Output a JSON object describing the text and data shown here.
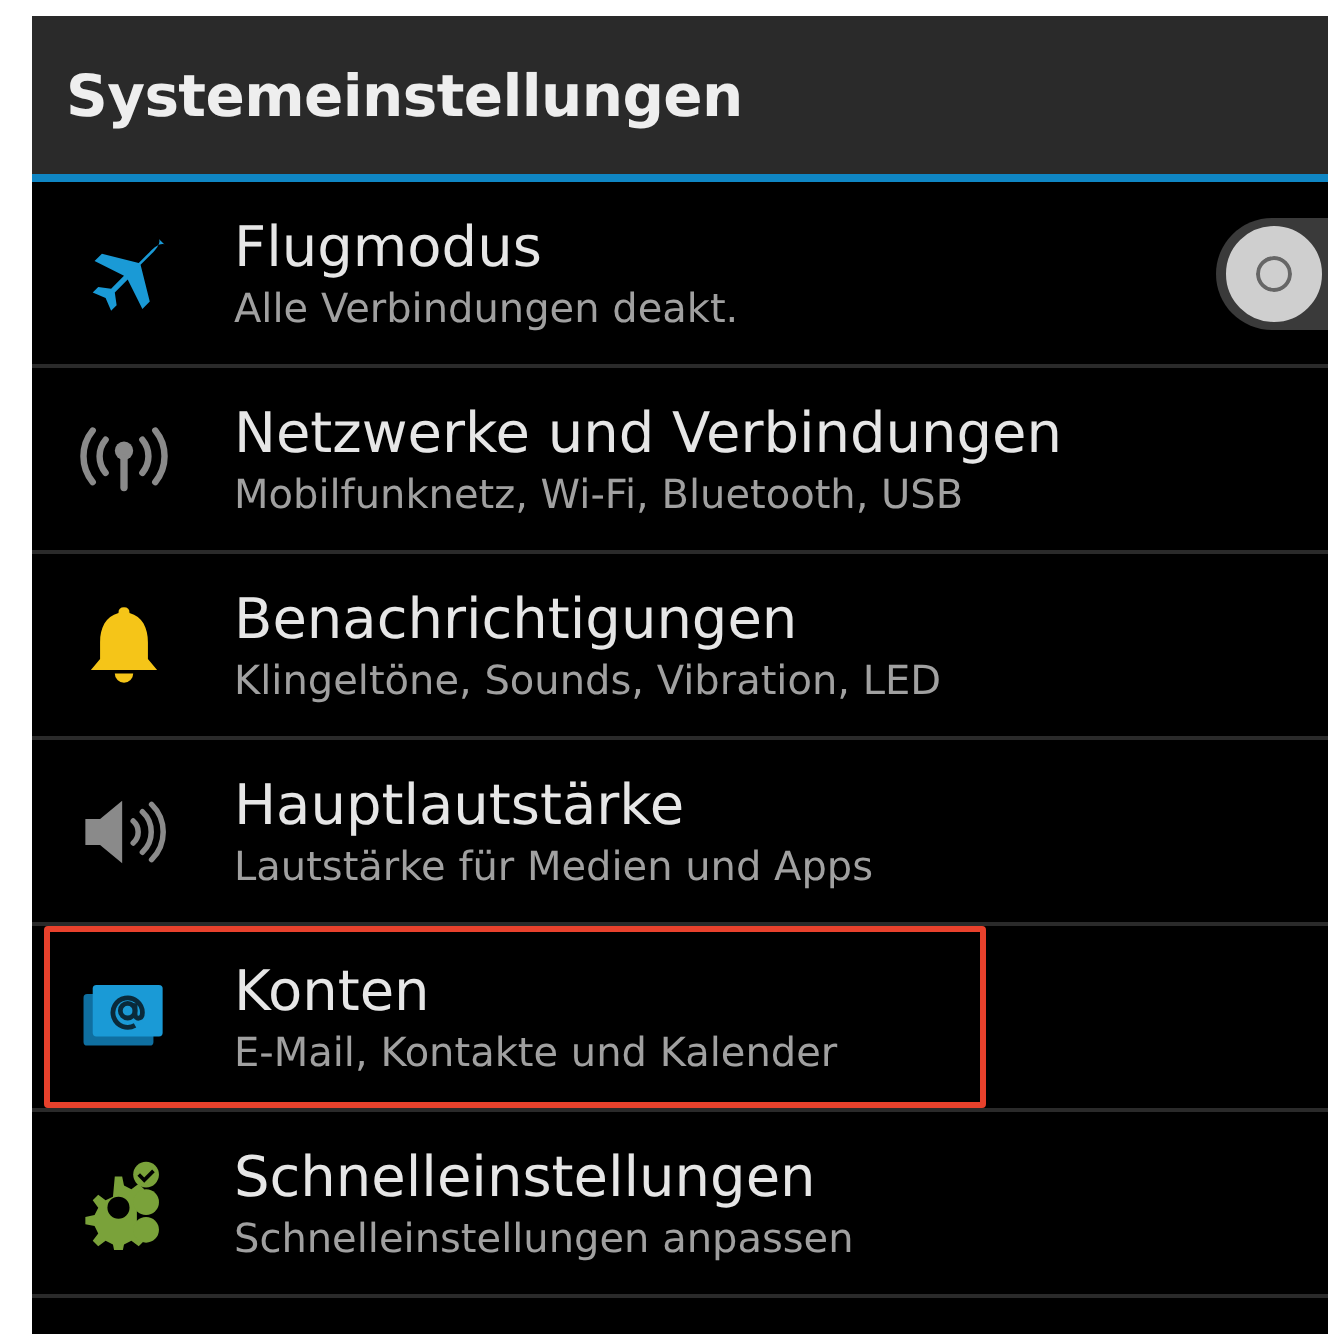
{
  "header": {
    "title": "Systemeinstellungen"
  },
  "items": [
    {
      "kind": "airplane",
      "title": "Flugmodus",
      "subtitle": "Alle Verbindungen deakt.",
      "toggle": {
        "on": false
      },
      "highlighted": false
    },
    {
      "kind": "antenna",
      "title": "Netzwerke und Verbindungen",
      "subtitle": "Mobilfunknetz, Wi-Fi, Bluetooth, USB",
      "highlighted": false
    },
    {
      "kind": "bell",
      "title": "Benachrichtigungen",
      "subtitle": "Klingeltöne, Sounds, Vibration, LED",
      "highlighted": false
    },
    {
      "kind": "speaker",
      "title": "Hauptlautstärke",
      "subtitle": "Lautstärke für Medien und Apps",
      "highlighted": false
    },
    {
      "kind": "accounts",
      "title": "Konten",
      "subtitle": "E-Mail, Kontakte und Kalender",
      "highlighted": true
    },
    {
      "kind": "quick",
      "title": "Schnelleinstellungen",
      "subtitle": "Schnelleinstellungen anpassen",
      "highlighted": false
    }
  ]
}
